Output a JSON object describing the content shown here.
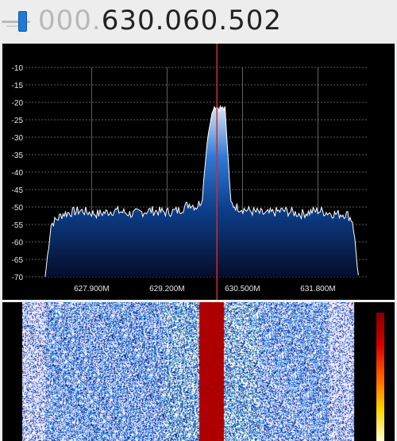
{
  "header": {
    "frequency_leading": "000.",
    "frequency_main": "630.060.502"
  },
  "chart_data": {
    "type": "area",
    "title": "",
    "xlabel": "",
    "ylabel": "",
    "y_ticks": [
      "-10",
      "-15",
      "-20",
      "-25",
      "-30",
      "-35",
      "-40",
      "-45",
      "-50",
      "-55",
      "-60",
      "-65",
      "-70"
    ],
    "x_ticks": [
      "627.900M",
      "629.200M",
      "630.500M",
      "631.800M"
    ],
    "x_tick_values": [
      627.9,
      629.2,
      630.5,
      631.8
    ],
    "ylim": [
      -70,
      -10
    ],
    "xlim": [
      626.76,
      632.67
    ],
    "grid": true,
    "tuned_frequency_mhz": 630.06,
    "series": [
      {
        "values_x": [
          627.1,
          627.2,
          627.4,
          627.7,
          628.0,
          628.3,
          628.6,
          628.9,
          629.2,
          629.4,
          629.6,
          629.7,
          629.8,
          629.9,
          630.0,
          630.1,
          630.2,
          630.3,
          630.4,
          630.6,
          630.9,
          631.2,
          631.5,
          631.8,
          632.1,
          632.3,
          632.4,
          632.5
        ],
        "values_y": [
          -70,
          -55,
          -52,
          -51,
          -52,
          -51,
          -52,
          -51,
          -51.5,
          -51,
          -49,
          -50,
          -48,
          -30,
          -21,
          -21.5,
          -22,
          -49,
          -50,
          -51,
          -52,
          -51,
          -52,
          -51,
          -52,
          -52,
          -54,
          -70
        ]
      }
    ]
  },
  "waterfall": {
    "label": ""
  }
}
